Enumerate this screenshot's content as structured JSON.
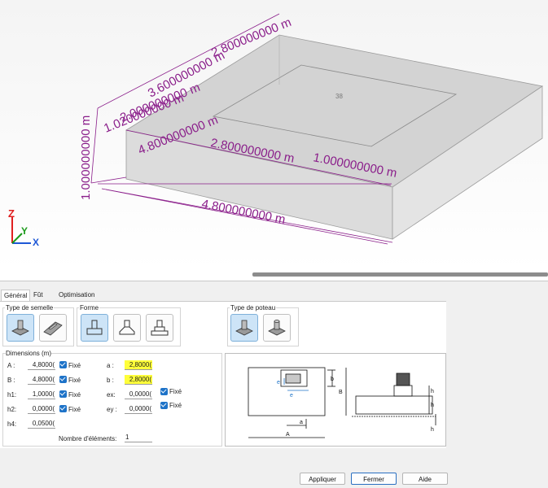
{
  "viewport": {
    "dims": [
      "3.600000000 m",
      "2.800000000 m",
      "1.020000000 m",
      "2.000000000 m",
      "4.800000000 m",
      "2.800000000 m",
      "1.000000000 m",
      "4.800000000 m",
      "1.000000000 m"
    ],
    "node_label": "38",
    "axes": {
      "z": "Z",
      "y": "Y",
      "x": "X"
    }
  },
  "tabs": [
    {
      "label": "Général"
    },
    {
      "label": "Fût"
    },
    {
      "label": "Optimisation"
    }
  ],
  "groups": {
    "semelle": "Type de semelle",
    "forme": "Forme",
    "poteau": "Type de poteau",
    "dimensions": "Dimensions (m)"
  },
  "dims": [
    {
      "label": "A :",
      "value": "4,8000(",
      "fixed": "Fixé"
    },
    {
      "label": "B :",
      "value": "4,8000(",
      "fixed": "Fixé"
    },
    {
      "label": "h1:",
      "value": "1,0000(",
      "fixed": "Fixé"
    },
    {
      "label": "h2:",
      "value": "0,0000(",
      "fixed": "Fixé"
    },
    {
      "label": "h4:",
      "value": "0,0500("
    }
  ],
  "col": [
    {
      "label": "a :",
      "value": "2,8000(",
      "fixed": ""
    },
    {
      "label": "b :",
      "value": "2,8000(",
      "fixed": ""
    },
    {
      "label": "ex:",
      "value": "0,0000(",
      "fixed": "Fixé"
    },
    {
      "label": "ey :",
      "value": "0,0000(",
      "fixed": "Fixé"
    }
  ],
  "count": {
    "label": "Nombre d'éléments:",
    "value": "1"
  },
  "schema": {
    "b": "b",
    "B": "B",
    "a": "a",
    "A": "A",
    "ey": "e",
    "ex": "e",
    "h2": "h",
    "h1": "h",
    "h4": "h"
  },
  "buttons": {
    "apply": "Appliquer",
    "close": "Fermer",
    "help": "Aide"
  },
  "colors": {
    "dimension": "#8a1d8a",
    "accent": "#1e73c8",
    "highlight": "#ffff3a"
  }
}
